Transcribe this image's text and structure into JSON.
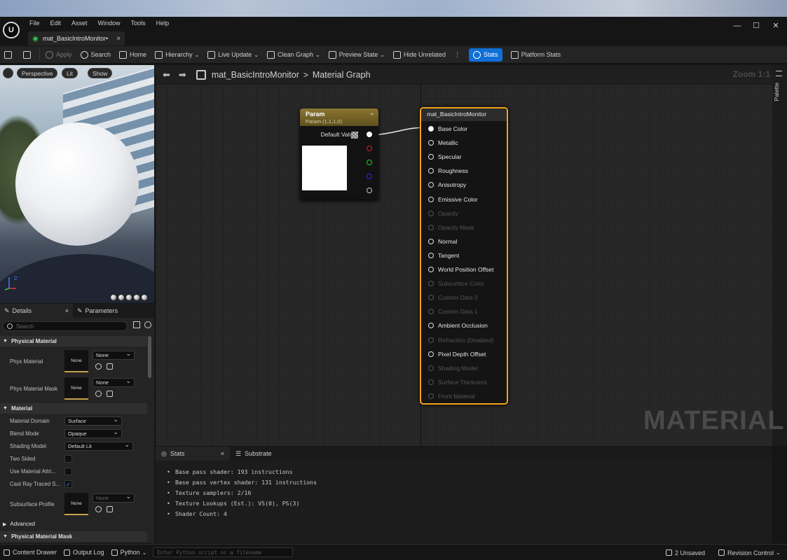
{
  "menu": [
    "File",
    "Edit",
    "Asset",
    "Window",
    "Tools",
    "Help"
  ],
  "document_tab": {
    "label": "mat_BasicIntroMonitor•",
    "close": "×"
  },
  "window_controls": {
    "minimize": "—",
    "maximize": "☐",
    "close": "✕"
  },
  "toolbar": {
    "apply": "Apply",
    "search": "Search",
    "home": "Home",
    "hierarchy": "Hierarchy",
    "live_update": "Live Update",
    "clean_graph": "Clean Graph",
    "preview_state": "Preview State",
    "hide_unrelated": "Hide Unrelated",
    "stats": "Stats",
    "platform_stats": "Platform Stats"
  },
  "viewport": {
    "perspective": "Perspective",
    "lit": "Lit",
    "show": "Show",
    "axis_z": "Z"
  },
  "details_panel": {
    "tab_details": "Details",
    "tab_parameters": "Parameters",
    "search_placeholder": "Search",
    "categories": {
      "physical_material": "Physical Material",
      "material": "Material",
      "advanced": "Advanced",
      "physical_material_mask": "Physical Material Mask"
    },
    "phys_material": {
      "label": "Phys Material",
      "thumb": "None",
      "value": "None"
    },
    "phys_material_mask": {
      "label": "Phys Material Mask",
      "thumb": "None",
      "value": "None"
    },
    "material_domain": {
      "label": "Material Domain",
      "value": "Surface"
    },
    "blend_mode": {
      "label": "Blend Mode",
      "value": "Opaque"
    },
    "shading_model": {
      "label": "Shading Model",
      "value": "Default Lit"
    },
    "two_sided": {
      "label": "Two Sided",
      "checked": false
    },
    "use_material_attributes": {
      "label": "Use Material Attri...",
      "checked": false
    },
    "cast_ray_traced": {
      "label": "Cast Ray Traced S...",
      "checked": true,
      "mark": "✓"
    },
    "subsurface_profile": {
      "label": "Subsurface Profile",
      "thumb": "None",
      "value": "None"
    }
  },
  "graph": {
    "breadcrumb_asset": "mat_BasicIntroMonitor",
    "breadcrumb_sep": ">",
    "breadcrumb_graph": "Material Graph",
    "zoom": "Zoom 1:1",
    "palette": "Palette",
    "watermark": "MATERIAL"
  },
  "param_node": {
    "title": "Param",
    "subtitle": "Param (1,1,1,0)",
    "default_value_label": "Default Value",
    "collapse": "⌃"
  },
  "material_node": {
    "title": "mat_BasicIntroMonitor",
    "pins": [
      {
        "label": "Base Color",
        "enabled": true,
        "connected": true
      },
      {
        "label": "Metallic",
        "enabled": true
      },
      {
        "label": "Specular",
        "enabled": true
      },
      {
        "label": "Roughness",
        "enabled": true
      },
      {
        "label": "Anisotropy",
        "enabled": true
      },
      {
        "label": "Emissive Color",
        "enabled": true
      },
      {
        "label": "Opacity",
        "enabled": false
      },
      {
        "label": "Opacity Mask",
        "enabled": false
      },
      {
        "label": "Normal",
        "enabled": true
      },
      {
        "label": "Tangent",
        "enabled": true
      },
      {
        "label": "World Position Offset",
        "enabled": true
      },
      {
        "label": "Subsurface Color",
        "enabled": false
      },
      {
        "label": "Custom Data 0",
        "enabled": false
      },
      {
        "label": "Custom Data 1",
        "enabled": false
      },
      {
        "label": "Ambient Occlusion",
        "enabled": true
      },
      {
        "label": "Refraction (Disabled)",
        "enabled": false
      },
      {
        "label": "Pixel Depth Offset",
        "enabled": true
      },
      {
        "label": "Shading Model",
        "enabled": false
      },
      {
        "label": "Surface Thickness",
        "enabled": false
      },
      {
        "label": "Front Material",
        "enabled": false
      }
    ]
  },
  "bottom_panel": {
    "tab_stats": "Stats",
    "tab_substrate": "Substrate",
    "close": "×",
    "stats": [
      "Base pass shader: 193 instructions",
      "Base pass vertex shader: 131 instructions",
      "Texture samplers: 2/16",
      "Texture Lookups (Est.): VS(0), PS(3)",
      "Shader Count: 4"
    ]
  },
  "statusbar": {
    "content_drawer": "Content Drawer",
    "output_log": "Output Log",
    "python": "Python",
    "python_placeholder": "Enter Python script or a filename",
    "unsaved": "2 Unsaved",
    "revision_control": "Revision Control"
  },
  "colors": {
    "accent": "#0f6fd6",
    "node_border": "#f1a21b",
    "param_header": "#8b7630"
  }
}
